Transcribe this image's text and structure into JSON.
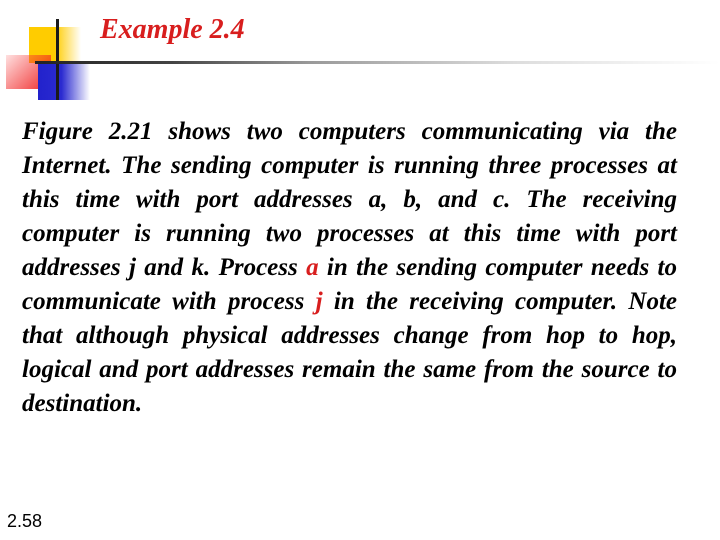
{
  "slide": {
    "title": "Example 2.4",
    "body_parts": [
      "Figure 2.21 shows two computers communicating via the Internet. The sending computer is running three processes at this time with port addresses a, b, and c. The receiving computer is running two processes at this time with port addresses j and k. Process ",
      "a",
      " in the sending computer needs to communicate with process ",
      "j",
      " in the receiving computer. Note that although physical addresses change from hop to hop, logical and port addresses remain the same from the source to destination."
    ],
    "slide_number": "2.58"
  },
  "colors": {
    "title": "#d81e1e",
    "highlight": "#d81e1e",
    "text": "#000000"
  }
}
